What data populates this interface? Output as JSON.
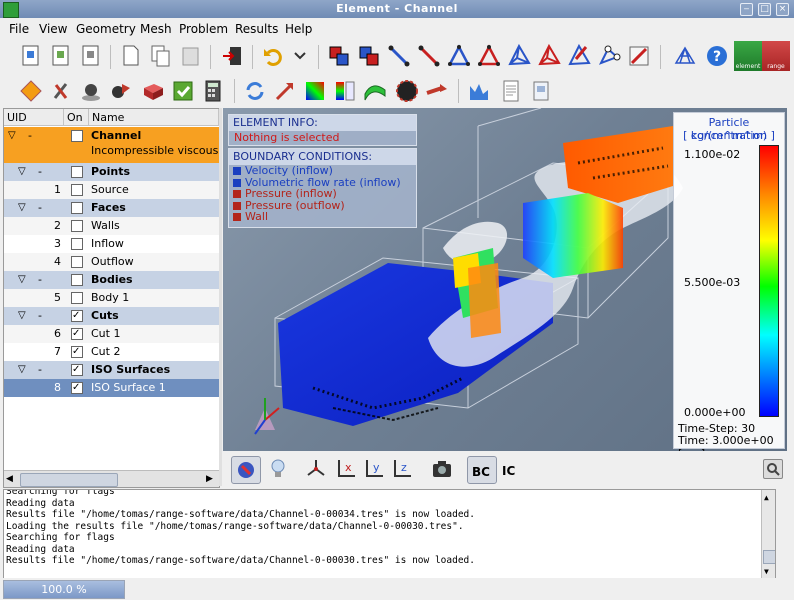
{
  "window": {
    "title": "Element - Channel"
  },
  "menu": [
    "File",
    "View",
    "Geometry",
    "Mesh",
    "Problem",
    "Results",
    "Help"
  ],
  "brand": {
    "left_label": "element",
    "right_label": "range"
  },
  "tree": {
    "headers": [
      "UID",
      "On",
      "Name"
    ],
    "rows": [
      {
        "uid": "-",
        "name": "Channel",
        "sub": "Incompressible viscous",
        "type": "root",
        "on": false
      },
      {
        "uid": "-",
        "name": "Points",
        "type": "group",
        "on": false
      },
      {
        "uid": "1",
        "name": "Source",
        "type": "item",
        "on": false
      },
      {
        "uid": "-",
        "name": "Faces",
        "type": "group",
        "on": false
      },
      {
        "uid": "2",
        "name": "Walls",
        "type": "item",
        "on": false
      },
      {
        "uid": "3",
        "name": "Inflow",
        "type": "item",
        "on": false
      },
      {
        "uid": "4",
        "name": "Outflow",
        "type": "item",
        "on": false
      },
      {
        "uid": "-",
        "name": "Bodies",
        "type": "group",
        "on": false
      },
      {
        "uid": "5",
        "name": "Body 1",
        "type": "item",
        "on": false
      },
      {
        "uid": "-",
        "name": "Cuts",
        "type": "group",
        "on": true
      },
      {
        "uid": "6",
        "name": "Cut 1",
        "type": "item",
        "on": true
      },
      {
        "uid": "7",
        "name": "Cut 2",
        "type": "item",
        "on": true
      },
      {
        "uid": "-",
        "name": "ISO Surfaces",
        "type": "group",
        "on": true
      },
      {
        "uid": "8",
        "name": "ISO Surface 1",
        "type": "item",
        "on": true,
        "selected": true
      }
    ]
  },
  "element_info": {
    "title": "ELEMENT INFO:",
    "text": "Nothing is selected"
  },
  "boundary_conditions": {
    "title": "BOUNDARY CONDITIONS:",
    "items": [
      {
        "label": "Velocity (inflow)",
        "color": "#1a3fc0"
      },
      {
        "label": "Volumetric flow rate (inflow)",
        "color": "#1a3fc0"
      },
      {
        "label": "Pressure (inflow)",
        "color": "#b3241a"
      },
      {
        "label": "Pressure (outflow)",
        "color": "#b3241a"
      },
      {
        "label": "Wall",
        "color": "#b3241a"
      }
    ]
  },
  "legend": {
    "title": "Particle concentration",
    "unit": "[ kg/(m^m^m) ]",
    "max": "1.100e-02",
    "mid": "5.500e-03",
    "min": "0.000e+00",
    "timestep": "Time-Step: 30",
    "time": "Time: 3.000e+00 [sec]"
  },
  "view_toolbar": {
    "bc_label": "BC",
    "ic_label": "IC",
    "x": "x",
    "y": "y",
    "z": "z"
  },
  "log_lines": [
    "Searching for flags",
    "Reading data",
    "Results file \"/home/tomas/range-software/data/Channel-0-00034.tres\" is now loaded.",
    "Loading the results file \"/home/tomas/range-software/data/Channel-0-00030.tres\".",
    "Searching for flags",
    "Reading data",
    "Results file \"/home/tomas/range-software/data/Channel-0-00030.tres\" is now loaded."
  ],
  "status": {
    "progress": "100.0 %",
    "progress_value": 1.0
  },
  "colors": {
    "selection": "#f7a021",
    "group_row": "#c6d2e4",
    "selected_row": "#6f8fbf",
    "accent": "#f7a021"
  }
}
